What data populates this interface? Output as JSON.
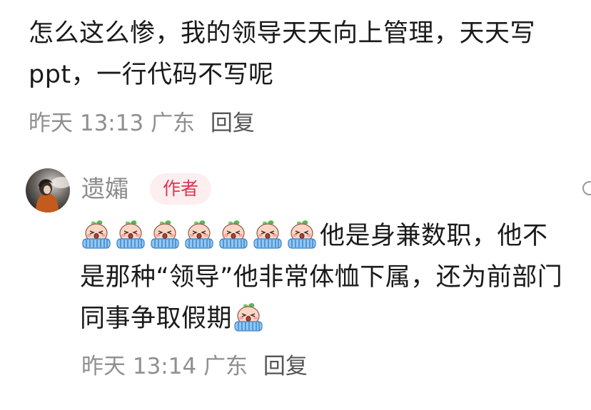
{
  "comments": [
    {
      "text": "怎么这么惨，我的领导天天向上管理，天天写ppt，一行代码不写呢",
      "time": "昨天 13:13",
      "location": "广东",
      "reply_label": "回复"
    },
    {
      "username": "遗孀",
      "badge": "作者",
      "avatar_icon": "avatar-photo",
      "leading_emoji_icon": "crying-peach-emoji",
      "leading_emoji_count": 7,
      "text": "他是身兼数职，他不是那种“领导”他非常体恤下属，还为前部门同事争取假期",
      "trailing_emoji_icon": "crying-peach-emoji",
      "time": "昨天 13:14",
      "location": "广东",
      "reply_label": "回复"
    }
  ],
  "colors": {
    "text": "#1a1a1a",
    "meta": "#8f8f8f",
    "reply": "#555555",
    "badge_bg": "#fdeef0",
    "badge_text": "#e0344e"
  }
}
